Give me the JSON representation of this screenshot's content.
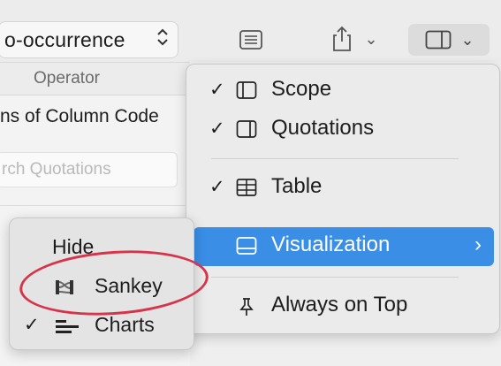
{
  "toolbar": {
    "popup_value": "o-occurrence",
    "popup_icon": "updown-chevron-icon",
    "list_icon": "list-view-icon",
    "share_icon": "share-icon",
    "share_chevron": "⌄",
    "panel_icon": "sidebar-right-icon",
    "panel_chevron": "⌄"
  },
  "content": {
    "column_header": "Operator",
    "row_value": "ns of Column Code",
    "search_placeholder": "rch Quotations"
  },
  "menu": {
    "items": [
      {
        "label": "Scope",
        "checked": true,
        "icon": "sidebar-left-icon"
      },
      {
        "label": "Quotations",
        "checked": true,
        "icon": "sidebar-right-icon"
      },
      {
        "label": "Table",
        "checked": true,
        "icon": "table-icon"
      },
      {
        "label": "Visualization",
        "checked": false,
        "icon": "bottom-panel-icon",
        "submenu_chevron": "›"
      },
      {
        "label": "Always on Top",
        "checked": false,
        "icon": "pin-icon"
      }
    ],
    "check_glyph": "✓"
  },
  "submenu": {
    "items": [
      {
        "label": "Hide",
        "checked": false
      },
      {
        "label": "Sankey",
        "checked": false,
        "icon": "sankey-icon"
      },
      {
        "label": "Charts",
        "checked": true,
        "icon": "bar-chart-icon"
      }
    ]
  },
  "colors": {
    "selection": "#3a8ee6",
    "highlight_ring": "#d6344a"
  }
}
